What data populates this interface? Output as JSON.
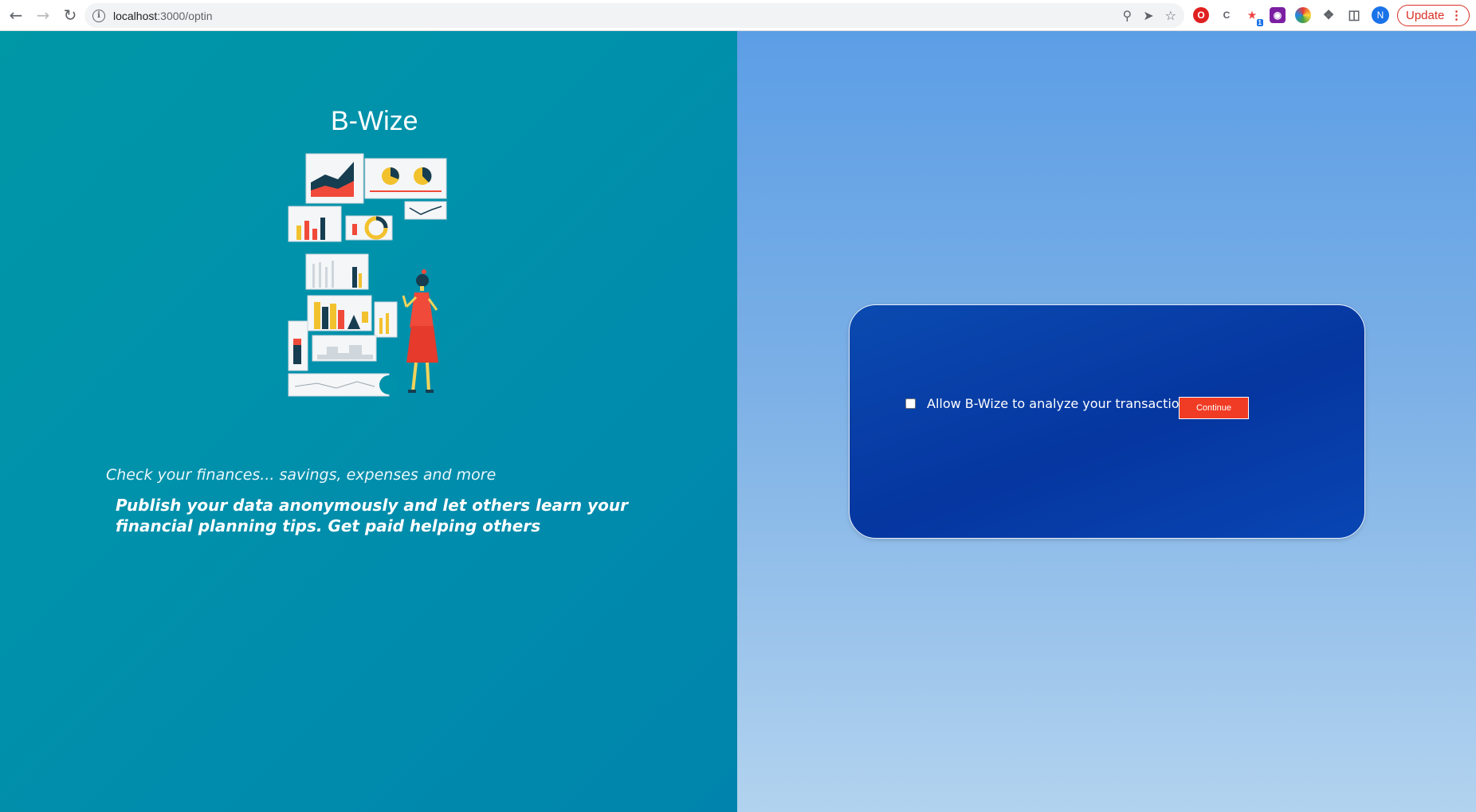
{
  "browser": {
    "url_host": "localhost",
    "url_path": ":3000/optin",
    "avatar_initial": "N",
    "update_label": "Update",
    "extension_badge": "1"
  },
  "left": {
    "brand": "B-Wize",
    "tagline": "Check your finances... savings, expenses and more",
    "pitch": "Publish your data anonymously and let others learn your financial planning tips. Get paid helping others"
  },
  "optin": {
    "checkbox_label": "Allow B-Wize to analyze your transactions",
    "checkbox_checked": false,
    "continue_label": "Continue"
  },
  "colors": {
    "left_bg": "#0091ab",
    "right_bg_top": "#5c9ee6",
    "card_bg": "#0636a0",
    "button_bg": "#f03c24"
  }
}
